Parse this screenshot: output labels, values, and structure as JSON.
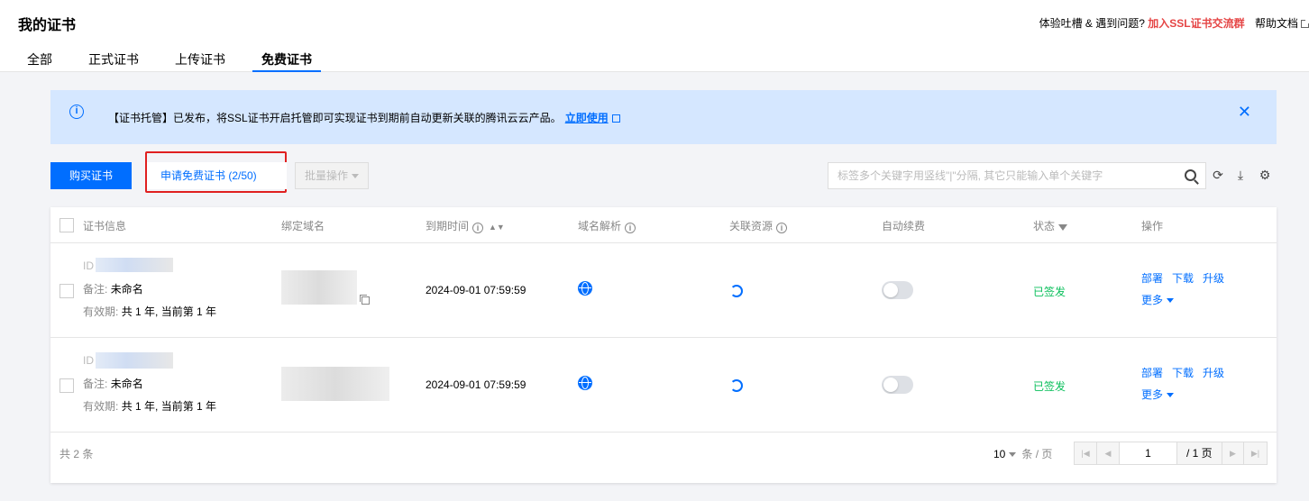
{
  "header": {
    "title": "我的证书",
    "feedback_text": "体验吐槽 & 遇到问题?",
    "join_group_link": "加入SSL证书交流群",
    "help_link": "帮助文档"
  },
  "tabs": [
    {
      "label": "全部"
    },
    {
      "label": "正式证书"
    },
    {
      "label": "上传证书"
    },
    {
      "label": "免费证书",
      "active": true
    }
  ],
  "notice": {
    "text": "【证书托管】已发布，将SSL证书开启托管即可实现证书到期前自动更新关联的腾讯云云产品。",
    "link": "立即使用"
  },
  "toolbar": {
    "buy_label": "购买证书",
    "apply_free_label": "申请免费证书 (2/50)",
    "batch_label": "批量操作",
    "search_placeholder": "标签多个关键字用竖线\"|\"分隔, 其它只能输入单个关键字"
  },
  "table": {
    "columns": [
      "证书信息",
      "绑定域名",
      "到期时间",
      "域名解析",
      "关联资源",
      "自动续费",
      "状态",
      "操作"
    ],
    "rows": [
      {
        "id_label": "ID",
        "note_label": "备注:",
        "note": "未命名",
        "valid_label": "有效期:",
        "valid": "共 1 年, 当前第 1 年",
        "expire": "2024-09-01 07:59:59",
        "auto_renew": false,
        "status": "已签发",
        "ops": [
          "部署",
          "下载",
          "升级"
        ],
        "more": "更多"
      },
      {
        "id_label": "ID",
        "note_label": "备注:",
        "note": "未命名",
        "valid_label": "有效期:",
        "valid": "共 1 年, 当前第 1 年",
        "expire": "2024-09-01 07:59:59",
        "auto_renew": false,
        "status": "已签发",
        "ops": [
          "部署",
          "下载",
          "升级"
        ],
        "more": "更多"
      }
    ]
  },
  "footer": {
    "total": "共 2 条",
    "page_size": "10",
    "page_size_unit": "条 / 页",
    "current_page": "1",
    "total_pages": "/ 1 页"
  },
  "colors": {
    "primary": "#006eff",
    "danger": "#e54545",
    "success": "#0abf5b",
    "highlight_border": "#e02020"
  }
}
